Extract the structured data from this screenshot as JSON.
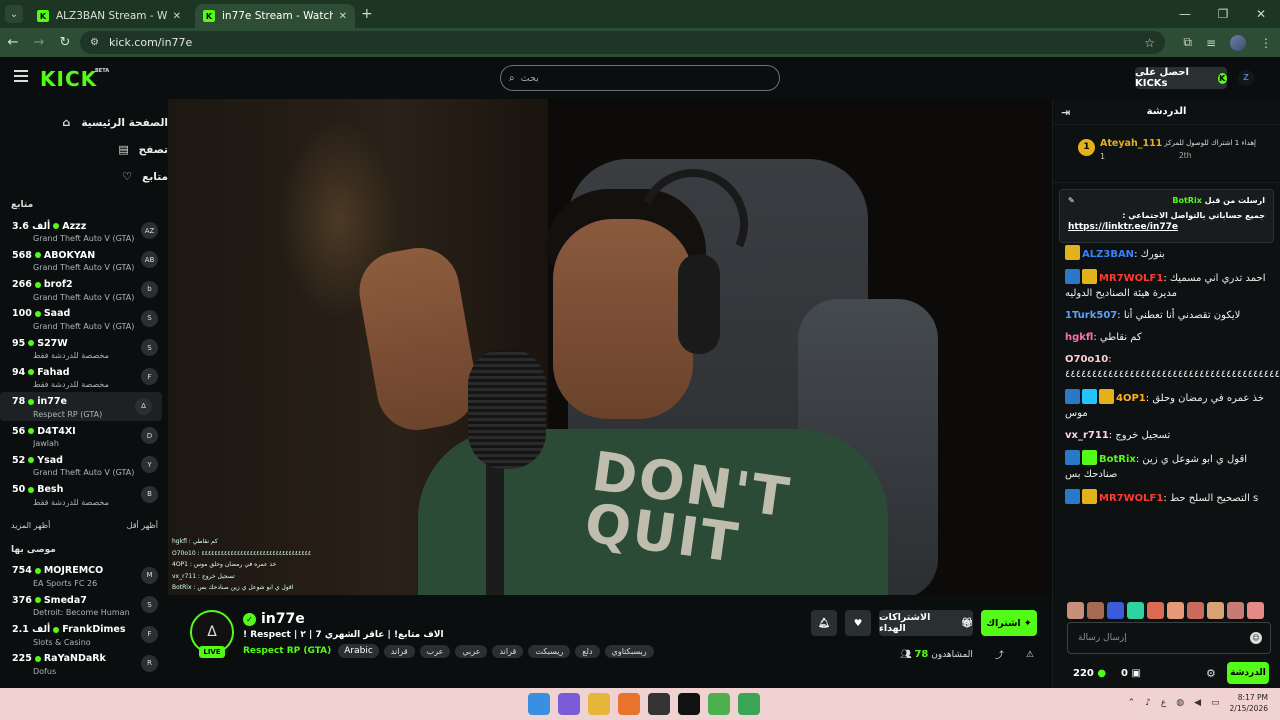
{
  "browser": {
    "tabs": [
      {
        "title": "ALZ3BAN Stream - Watch Live o"
      },
      {
        "title": "in77e Stream - Watch Live on K"
      }
    ],
    "url": "kick.com/in77e"
  },
  "topnav": {
    "logo": "KICK",
    "beta": "BETA",
    "search_placeholder": "بحث",
    "get_kicks": "احصل على KICKs",
    "user_initial": "Z"
  },
  "sidebar": {
    "nav": [
      {
        "label": "الصفحة الرئيسية",
        "icon": "home-icon",
        "glyph": "⌂"
      },
      {
        "label": "تصفح",
        "icon": "browse-icon",
        "glyph": "▤"
      },
      {
        "label": "متابع",
        "icon": "heart-icon",
        "glyph": "♡"
      }
    ],
    "following_title": "متابع",
    "following": [
      {
        "name": "Azzz",
        "count": "3.6 ألف",
        "game": "Grand Theft Auto V (GTA)",
        "av": "AZ"
      },
      {
        "name": "ABOKYAN",
        "count": "568",
        "game": "Grand Theft Auto V (GTA)",
        "av": "AB"
      },
      {
        "name": "brof2",
        "count": "266",
        "game": "Grand Theft Auto V (GTA)",
        "av": "b"
      },
      {
        "name": "Saad",
        "count": "100",
        "game": "Grand Theft Auto V (GTA)",
        "av": "S"
      },
      {
        "name": "S27W",
        "count": "95",
        "game": "مخصصة للدردشة فقط",
        "av": "S"
      },
      {
        "name": "Fahad",
        "count": "94",
        "game": "مخصصة للدردشة فقط",
        "av": "F"
      },
      {
        "name": "in77e",
        "count": "78",
        "game": "Respect RP (GTA)",
        "av": "Δ",
        "active": true
      },
      {
        "name": "D4T4XI",
        "count": "56",
        "game": "Jawlah",
        "av": "D"
      },
      {
        "name": "Ysad",
        "count": "52",
        "game": "Grand Theft Auto V (GTA)",
        "av": "Y"
      },
      {
        "name": "Besh",
        "count": "50",
        "game": "مخصصة للدردشة فقط",
        "av": "B"
      }
    ],
    "show_more": "أظهر المزيد",
    "show_less": "أظهر أقل",
    "recommended_title": "موصى بها",
    "recommended": [
      {
        "name": "MOJREMCO",
        "count": "754",
        "game": "EA Sports FC 26",
        "av": "M"
      },
      {
        "name": "Smeda7",
        "count": "376",
        "game": "Detroit: Become Human",
        "av": "S"
      },
      {
        "name": "FrankDimes",
        "count": "2.1 ألف",
        "game": "Slots & Casino",
        "av": "F"
      },
      {
        "name": "RaYaNDaRk",
        "count": "225",
        "game": "Dofus",
        "av": "R"
      }
    ]
  },
  "video_overlay_chat": [
    "hgkfl : كم نقاطي",
    "O70o10 : ٤٤٤٤٤٤٤٤٤٤٤٤٤٤٤٤٤٤٤٤٤٤٤٤٤٤٤٤٤٤٤٤٤٤",
    "4OP1 : خذ عمره في رمضان وحلق موس",
    "vx_r711 : تسجيل خروج",
    "BotRix : اقول ي ابو شوعل ي زين صنادحك بس"
  ],
  "video_shirt_text": "DON'T QUIT",
  "stream": {
    "channel": "in77e",
    "live": "LIVE",
    "title": "! Respect | ٢ | 7 الاف متابع! | عاقر الشهري",
    "category": "Respect RP (GTA)",
    "tags": [
      "Arabic",
      "قراند",
      "عرب",
      "عربي",
      "قراند",
      "ريسبكت",
      "دلع",
      "ريسبكتاوي"
    ],
    "subscribe": "اشتراك",
    "gift_subs": "الاشتراكات الهداء",
    "viewers_label": "المشاهدون",
    "viewers": "78"
  },
  "chat": {
    "title": "الدردشة",
    "top_gifter": {
      "rank": "1",
      "name": "Ateyah_111",
      "count": "1",
      "text": "إهداء 1 اشتراك للوصول للمركز",
      "position": "2th"
    },
    "pinned": {
      "by_label": "ارسلت من قبل",
      "by_user": "BotRix",
      "text": "جميع حساباتي بالتواصل الاجتماعي :",
      "link": "https://linktr.ee/in77e"
    },
    "messages": [
      {
        "user": "ALZ3BAN",
        "color": "#3b82f6",
        "text": "بنورك",
        "badges": [
          "#e3b21a"
        ]
      },
      {
        "user": "MR7WOLF1",
        "color": "#ff3b30",
        "text": "احمد تدري اني مسميك مديرة هيئة الصناديح الدوليه",
        "badges": [
          "#2a78c8",
          "#e3b21a"
        ]
      },
      {
        "user": "1Turk507",
        "color": "#5aa0ff",
        "text": "لايكون تقصدني أنا تعطني أنا",
        "badges": []
      },
      {
        "user": "hgkfl",
        "color": "#ff6fb5",
        "text": "كم نقاطي",
        "badges": []
      },
      {
        "user": "O70o10",
        "color": "#ffcfcf",
        "text": "٤٤٤٤٤٤٤٤٤٤٤٤٤٤٤٤٤٤٤٤٤٤٤٤٤٤٤٤٤٤٤٤٤٤٤٤٤٤٤٤٤٤٤٤٤٤",
        "badges": []
      },
      {
        "user": "4OP1",
        "color": "#ffb020",
        "text": "خذ عمره في رمضان وحلق موس",
        "badges": [
          "#2a78c8",
          "#22c3ff",
          "#e3b21a"
        ]
      },
      {
        "user": "vx_r711",
        "color": "#ffd6e6",
        "text": "تسجيل خروج",
        "badges": []
      },
      {
        "user": "BotRix",
        "color": "#53fc18",
        "text": "اقول ي ابو شوعل ي زين صنادحك بس",
        "badges": [
          "#2a78c8",
          "#53fc18"
        ]
      },
      {
        "user": "MR7WOLF1",
        "color": "#ff3b30",
        "text": "التصحيح السلح حط s",
        "badges": [
          "#2a78c8",
          "#e3b21a"
        ]
      }
    ],
    "input_placeholder": "إرسال رسالة",
    "kicks_balance": "220",
    "zero": "0",
    "send": "الدردشة"
  },
  "taskbar": {
    "time": "8:17 PM",
    "date": "2/15/2026",
    "lang": "ع"
  }
}
